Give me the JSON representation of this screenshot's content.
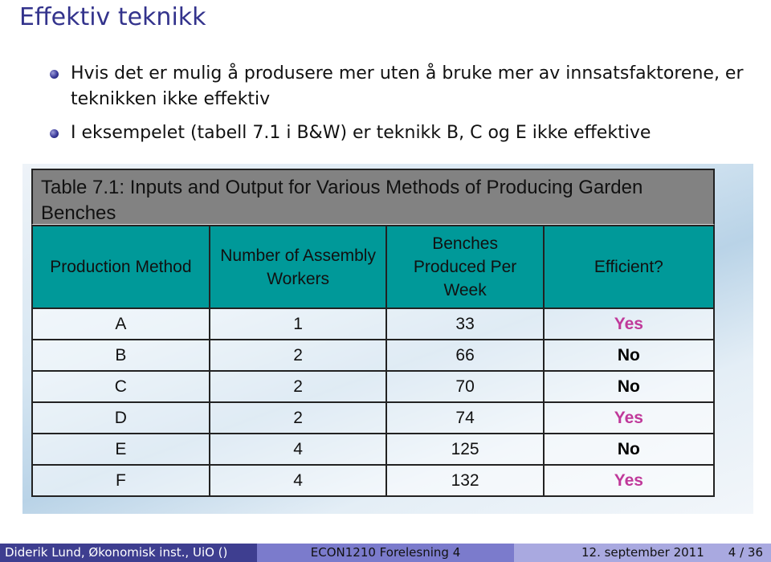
{
  "slide": {
    "title": "Effektiv teknikk",
    "bullets": [
      "Hvis det er mulig å produsere mer uten å bruke mer av innsatsfaktorene, er teknikken ikke effektiv",
      "I eksempelet (tabell 7.1 i B&W) er teknikk B, C og E ikke effektive"
    ]
  },
  "table": {
    "caption": "Table 7.1: Inputs and Output for Various Methods of Producing Garden Benches",
    "headers": [
      "Production Method",
      "Number of Assembly Workers",
      "Benches Produced Per Week",
      "Efficient?"
    ],
    "rows": [
      {
        "method": "A",
        "workers": "1",
        "benches": "33",
        "efficient": "Yes"
      },
      {
        "method": "B",
        "workers": "2",
        "benches": "66",
        "efficient": "No"
      },
      {
        "method": "C",
        "workers": "2",
        "benches": "70",
        "efficient": "No"
      },
      {
        "method": "D",
        "workers": "2",
        "benches": "74",
        "efficient": "Yes"
      },
      {
        "method": "E",
        "workers": "4",
        "benches": "125",
        "efficient": "No"
      },
      {
        "method": "F",
        "workers": "4",
        "benches": "132",
        "efficient": "Yes"
      }
    ],
    "colors": {
      "header_bg": "#009999",
      "caption_bg": "#828282",
      "yes": "#c0399a",
      "no": "#000000"
    }
  },
  "footer": {
    "author": "Diderik Lund, Økonomisk inst., UiO  ()",
    "course": "ECON1210 Forelesning 4",
    "date": "12. september 2011",
    "page": "4 / 36"
  }
}
